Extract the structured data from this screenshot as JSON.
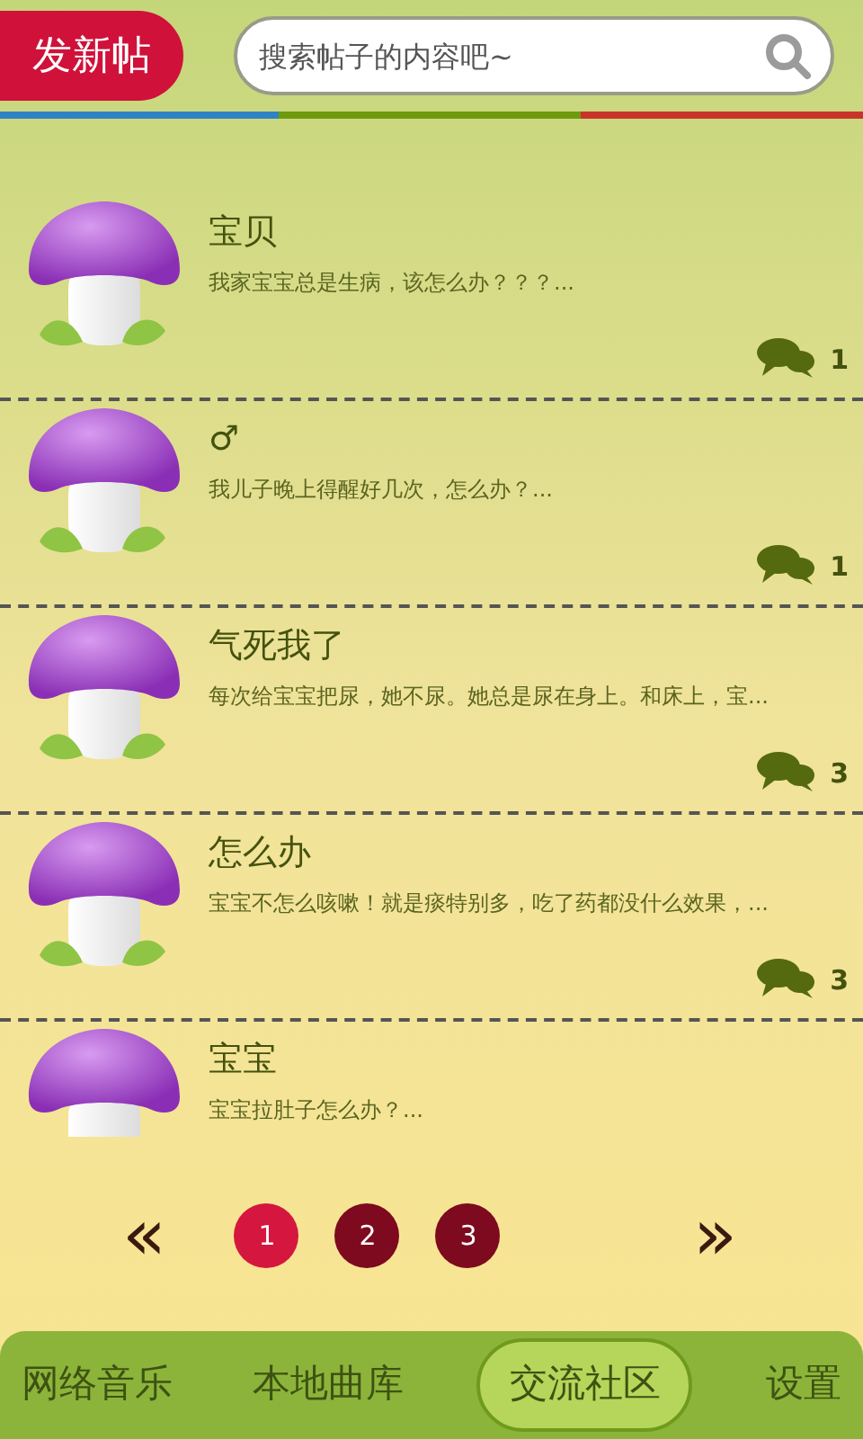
{
  "header": {
    "new_post_button": "发新帖",
    "search": {
      "placeholder": "搜索帖子的内容吧~"
    }
  },
  "posts": [
    {
      "title": "宝贝",
      "excerpt": "我家宝宝总是生病，该怎么办？？？...",
      "comments": "1"
    },
    {
      "title": "♂",
      "excerpt": "我儿子晚上得醒好几次，怎么办？...",
      "comments": "1"
    },
    {
      "title": "气死我了",
      "excerpt": "每次给宝宝把尿，她不尿。她总是尿在身上。和床上，宝...",
      "comments": "3"
    },
    {
      "title": "怎么办",
      "excerpt": "宝宝不怎么咳嗽！就是痰特别多，吃了药都没什么效果，...",
      "comments": "3"
    },
    {
      "title": "宝宝",
      "excerpt": "宝宝拉肚子怎么办？..."
    }
  ],
  "pagination": {
    "prev": "«",
    "next": "»",
    "pages": [
      {
        "label": "1",
        "selected": true
      },
      {
        "label": "2",
        "selected": false
      },
      {
        "label": "3",
        "selected": false
      }
    ]
  },
  "bottom_nav": [
    {
      "label": "网络音乐",
      "selected": false
    },
    {
      "label": "本地曲库",
      "selected": false
    },
    {
      "label": "交流社区",
      "selected": true
    },
    {
      "label": "设置",
      "selected": false
    }
  ]
}
